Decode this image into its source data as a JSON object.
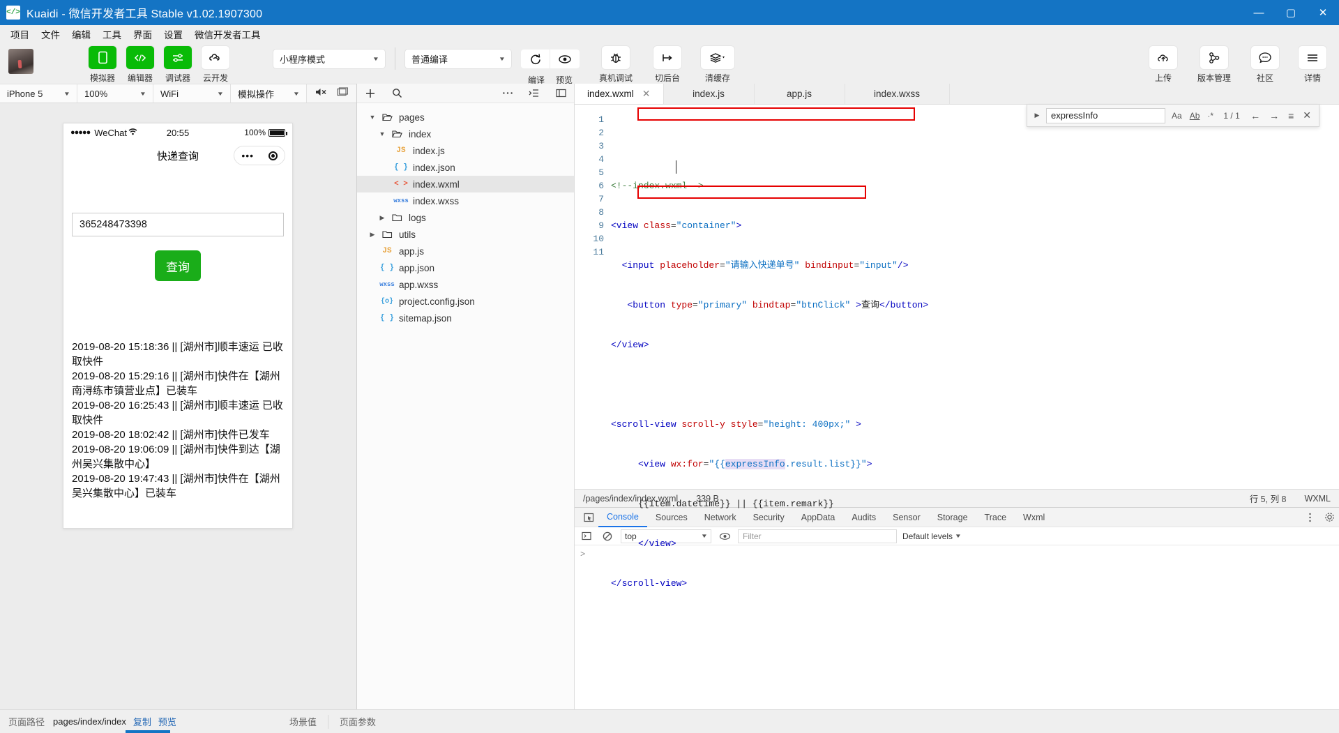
{
  "window": {
    "title": "Kuaidi - 微信开发者工具 Stable v1.02.1907300",
    "logo_text": "</>",
    "minimize": "—",
    "maximize": "▢",
    "close": "✕"
  },
  "menubar": {
    "items": [
      "项目",
      "文件",
      "编辑",
      "工具",
      "界面",
      "设置",
      "微信开发者工具"
    ]
  },
  "toolbar": {
    "left_buttons": [
      {
        "label": "模拟器",
        "icon": "phone-icon",
        "active": true
      },
      {
        "label": "编辑器",
        "icon": "code-icon",
        "active": true
      },
      {
        "label": "调试器",
        "icon": "sliders-icon",
        "active": true
      },
      {
        "label": "云开发",
        "icon": "cloud-dev-icon",
        "active": false
      }
    ],
    "mode_select": "小程序模式",
    "compile_select": "普通编译",
    "compile_label": "编译",
    "preview_label": "预览",
    "remote_debug_label": "真机调试",
    "background_label": "切后台",
    "clear_cache_label": "清缓存",
    "right_buttons": [
      {
        "label": "上传",
        "icon": "cloud-upload-icon"
      },
      {
        "label": "版本管理",
        "icon": "branch-icon"
      },
      {
        "label": "社区",
        "icon": "chat-icon"
      },
      {
        "label": "详情",
        "icon": "hamburger-icon"
      }
    ]
  },
  "simulator": {
    "tabs": [
      "模拟器",
      "编辑器",
      "调试器",
      "云开发"
    ],
    "device": "iPhone 5",
    "zoom": "100%",
    "network": "WiFi",
    "action": "模拟操作",
    "status_bar": {
      "signal_dots": "●●●●●",
      "carrier": "WeChat",
      "wifi_icon": "wifi-icon",
      "time": "20:55",
      "battery": "100%"
    },
    "nav_title": "快递查询",
    "capsule": {
      "dots": "•••",
      "target": "target-icon"
    },
    "input_value": "365248473398",
    "query_button": "查询",
    "express_list": [
      "2019-08-20 15:18:36 || [湖州市]顺丰速运 已收取快件",
      "2019-08-20 15:29:16 || [湖州市]快件在【湖州南浔练市镇营业点】已装车",
      "2019-08-20 16:25:43 || [湖州市]顺丰速运 已收取快件",
      "2019-08-20 18:02:42 || [湖州市]快件已发车",
      "2019-08-20 19:06:09 || [湖州市]快件到达【湖州吴兴集散中心】",
      "2019-08-20 19:47:43 || [湖州市]快件在【湖州吴兴集散中心】已装车"
    ]
  },
  "filetree": {
    "add_icon": "plus-icon",
    "search_icon": "search-icon",
    "more_icon": "ellipsis-icon",
    "collapse_icon": "collapse-icon",
    "sidebar_icon": "panel-icon",
    "nodes": [
      {
        "name": "pages",
        "type": "folder",
        "depth": 0,
        "open": true
      },
      {
        "name": "index",
        "type": "folder",
        "depth": 1,
        "open": true
      },
      {
        "name": "index.js",
        "type": "js",
        "depth": 2,
        "badge": "JS"
      },
      {
        "name": "index.json",
        "type": "json",
        "depth": 2,
        "badge": "{ }"
      },
      {
        "name": "index.wxml",
        "type": "wxml",
        "depth": 2,
        "badge": "< >",
        "selected": true
      },
      {
        "name": "index.wxss",
        "type": "wxss",
        "depth": 2,
        "badge": "wxss"
      },
      {
        "name": "logs",
        "type": "folder",
        "depth": 1,
        "open": false
      },
      {
        "name": "utils",
        "type": "folder",
        "depth": 0,
        "open": false
      },
      {
        "name": "app.js",
        "type": "js",
        "depth": 1,
        "badge": "JS"
      },
      {
        "name": "app.json",
        "type": "json",
        "depth": 1,
        "badge": "{ }"
      },
      {
        "name": "app.wxss",
        "type": "wxss",
        "depth": 1,
        "badge": "wxss"
      },
      {
        "name": "project.config.json",
        "type": "cfg",
        "depth": 1,
        "badge": "{o}"
      },
      {
        "name": "sitemap.json",
        "type": "json",
        "depth": 1,
        "badge": "{ }"
      }
    ]
  },
  "editor": {
    "tabs": [
      {
        "label": "index.wxml",
        "active": true,
        "close": "✕"
      },
      {
        "label": "index.js",
        "active": false
      },
      {
        "label": "app.js",
        "active": false
      },
      {
        "label": "index.wxss",
        "active": false
      }
    ],
    "line_numbers": [
      "1",
      "2",
      "3",
      "4",
      "5",
      "6",
      "7",
      "8",
      "9",
      "10",
      "11"
    ],
    "code_lines": [
      "<!--index.wxml-->",
      "<view class=\"container\">",
      "  <input placeholder=\"请输入快递单号\" bindinput=\"input\"/>",
      "   <button type=\"primary\" bindtap=\"btnClick\" >查询</button>",
      "</view>",
      "",
      "<scroll-view scroll-y style=\"height: 400px;\" >",
      "     <view wx:for=\"{{expressInfo.result.list}}\">",
      "     {{item.datetime}} || {{item.remark}}",
      "     </view>",
      "</scroll-view>"
    ],
    "find": {
      "query": "expressInfo",
      "match_case": "Aa",
      "whole_word": "Ab",
      "regex": "·*",
      "count": "1 / 1",
      "prev": "←",
      "next": "→",
      "select_all": "≡",
      "close": "✕"
    },
    "status": {
      "path": "/pages/index/index.wxml",
      "size": "339 B",
      "position": "行 5, 列 8",
      "language": "WXML"
    }
  },
  "devtools": {
    "tabs": [
      "Console",
      "Sources",
      "Network",
      "Security",
      "AppData",
      "Audits",
      "Sensor",
      "Storage",
      "Trace",
      "Wxml"
    ],
    "active_tab": "Console",
    "inspect_icon": "inspect-icon",
    "clear_icon": "clear-icon",
    "eye_icon": "eye-icon",
    "context": "top",
    "filter_placeholder": "Filter",
    "levels": "Default levels",
    "settings_icon": "gear-icon",
    "more_icon": "kebab-icon",
    "prompt": ">"
  },
  "bottombar": {
    "path_label": "页面路径",
    "path_value": "pages/index/index",
    "copy": "复制",
    "preview": "预览",
    "scene_label": "场景值",
    "params_label": "页面参数"
  },
  "colors": {
    "title_blue": "#1474c4",
    "wechat_green": "#09bb07",
    "button_green": "#1aad19",
    "red_box": "#e60000",
    "tab_blue": "#1a73e8"
  }
}
